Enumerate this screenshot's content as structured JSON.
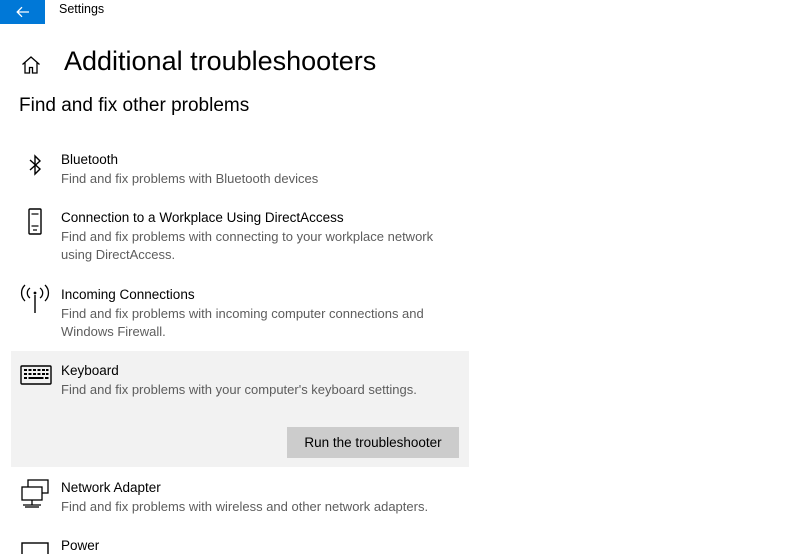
{
  "window": {
    "title": "Settings"
  },
  "page": {
    "title": "Additional troubleshooters",
    "section_title": "Find and fix other problems"
  },
  "items": [
    {
      "name": "Bluetooth",
      "description": "Find and fix problems with Bluetooth devices",
      "icon": "bluetooth-icon"
    },
    {
      "name": "Connection to a Workplace Using DirectAccess",
      "description": "Find and fix problems with connecting to your workplace network using DirectAccess.",
      "icon": "phone-device-icon"
    },
    {
      "name": "Incoming Connections",
      "description": "Find and fix problems with incoming computer connections and Windows Firewall.",
      "icon": "antenna-icon"
    },
    {
      "name": "Keyboard",
      "description": "Find and fix problems with your computer's keyboard settings.",
      "icon": "keyboard-icon",
      "selected": true,
      "action_label": "Run the troubleshooter"
    },
    {
      "name": "Network Adapter",
      "description": "Find and fix problems with wireless and other network adapters.",
      "icon": "network-adapter-icon"
    },
    {
      "name": "Power",
      "description": "",
      "icon": "power-icon"
    }
  ],
  "colors": {
    "accent": "#0078d7",
    "selected_bg": "#f2f2f2",
    "button_bg": "#cccccc",
    "secondary_text": "#5d5d5d"
  }
}
